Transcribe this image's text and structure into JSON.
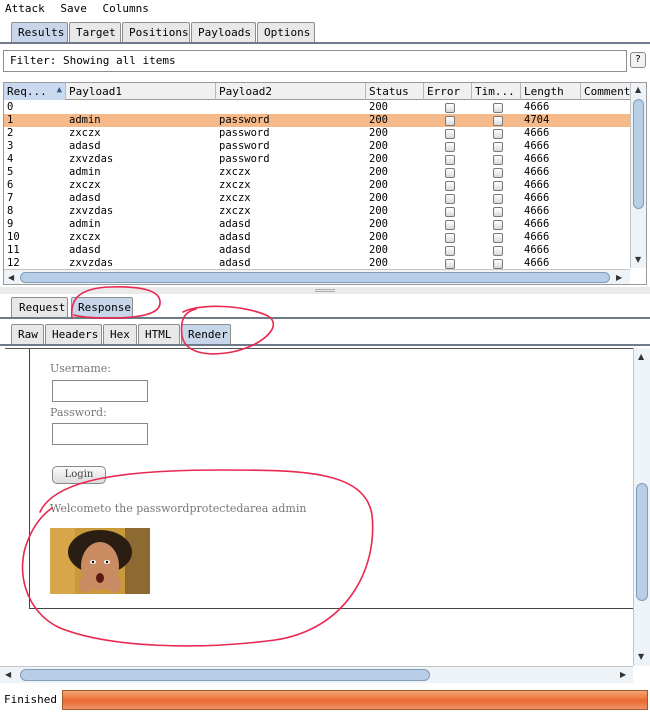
{
  "menu": [
    "Attack",
    "Save",
    "Columns"
  ],
  "top_tabs": [
    {
      "label": "Results",
      "active": true
    },
    {
      "label": "Target",
      "active": false
    },
    {
      "label": "Positions",
      "active": false
    },
    {
      "label": "Payloads",
      "active": false
    },
    {
      "label": "Options",
      "active": false
    }
  ],
  "filter": {
    "text": "Filter: Showing all items",
    "help_icon": "?"
  },
  "table": {
    "columns": [
      "Req...",
      "Payload1",
      "Payload2",
      "Status",
      "Error",
      "Tim...",
      "Length",
      "Comment"
    ],
    "sort_indicator": "▲",
    "selected_row": 1,
    "rows": [
      {
        "req": "0",
        "p1": "",
        "p2": "",
        "status": "200",
        "length": "4666"
      },
      {
        "req": "1",
        "p1": "admin",
        "p2": "password",
        "status": "200",
        "length": "4704"
      },
      {
        "req": "2",
        "p1": "zxczx",
        "p2": "password",
        "status": "200",
        "length": "4666"
      },
      {
        "req": "3",
        "p1": "adasd",
        "p2": "password",
        "status": "200",
        "length": "4666"
      },
      {
        "req": "4",
        "p1": "zxvzdas",
        "p2": "password",
        "status": "200",
        "length": "4666"
      },
      {
        "req": "5",
        "p1": "admin",
        "p2": "zxczx",
        "status": "200",
        "length": "4666"
      },
      {
        "req": "6",
        "p1": "zxczx",
        "p2": "zxczx",
        "status": "200",
        "length": "4666"
      },
      {
        "req": "7",
        "p1": "adasd",
        "p2": "zxczx",
        "status": "200",
        "length": "4666"
      },
      {
        "req": "8",
        "p1": "zxvzdas",
        "p2": "zxczx",
        "status": "200",
        "length": "4666"
      },
      {
        "req": "9",
        "p1": "admin",
        "p2": "adasd",
        "status": "200",
        "length": "4666"
      },
      {
        "req": "10",
        "p1": "zxczx",
        "p2": "adasd",
        "status": "200",
        "length": "4666"
      },
      {
        "req": "11",
        "p1": "adasd",
        "p2": "adasd",
        "status": "200",
        "length": "4666"
      },
      {
        "req": "12",
        "p1": "zxvzdas",
        "p2": "adasd",
        "status": "200",
        "length": "4666"
      }
    ]
  },
  "msg_tabs": [
    {
      "label": "Request",
      "active": false
    },
    {
      "label": "Response",
      "active": true
    }
  ],
  "view_tabs": [
    {
      "label": "Raw",
      "active": false
    },
    {
      "label": "Headers",
      "active": false
    },
    {
      "label": "Hex",
      "active": false
    },
    {
      "label": "HTML",
      "active": false
    },
    {
      "label": "Render",
      "active": true
    }
  ],
  "render": {
    "username_label": "Username:",
    "password_label": "Password:",
    "login_button": "Login",
    "welcome_text": "Welcometo the passwordprotectedarea admin"
  },
  "status": {
    "text": "Finished",
    "progress": 1.0
  },
  "colors": {
    "selected_row": "#f5b98a",
    "active_tab": "#c8d6ea",
    "progress": "#e86a30",
    "annotation": "#e8284f"
  }
}
